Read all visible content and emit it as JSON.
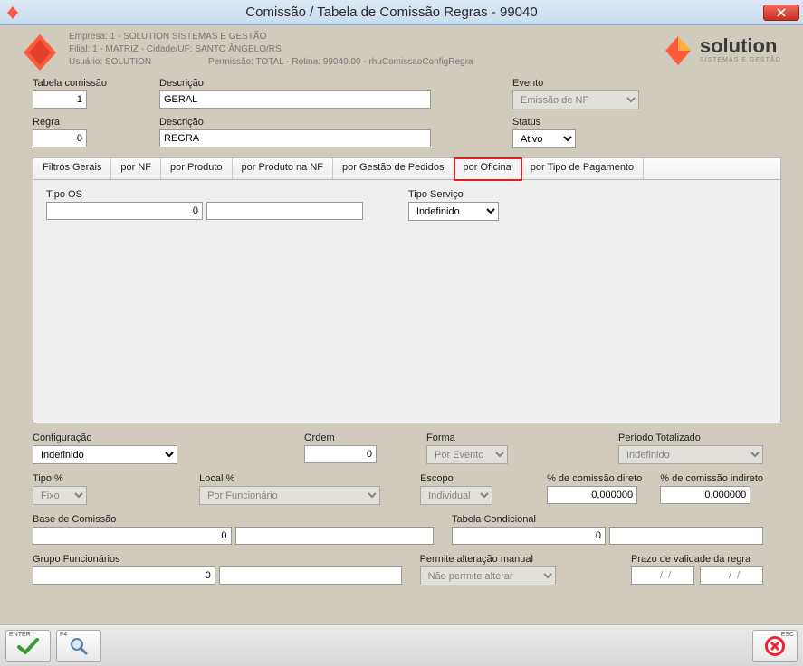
{
  "window": {
    "title": "Comissão / Tabela de Comissão Regras - 99040"
  },
  "meta": {
    "empresa": "Empresa: 1 - SOLUTION SISTEMAS E GESTÃO",
    "filial": "Filial: 1 - MATRIZ - Cidade/UF: SANTO ÂNGELO/RS",
    "usuario": "Usuário: SOLUTION",
    "permissao": "Permissão: TOTAL - Rotina: 99040.00 - rhuComissaoConfigRegra"
  },
  "brand": {
    "name": "solution",
    "tagline": "SISTEMAS E GESTÃO"
  },
  "top": {
    "tabela_label": "Tabela comissão",
    "tabela_val": "1",
    "desc1_label": "Descrição",
    "desc1_val": "GERAL",
    "evento_label": "Evento",
    "evento_val": "Emissão de NF",
    "regra_label": "Regra",
    "regra_val": "0",
    "desc2_label": "Descrição",
    "desc2_val": "REGRA",
    "status_label": "Status",
    "status_val": "Ativo"
  },
  "tabs": {
    "t0": "Filtros Gerais",
    "t1": "por NF",
    "t2": "por Produto",
    "t3": "por Produto na NF",
    "t4": "por Gestão de Pedidos",
    "t5": "por Oficina",
    "t6": "por Tipo de Pagamento"
  },
  "oficina": {
    "tipo_os_label": "Tipo OS",
    "tipo_os_val": "0",
    "tipo_os_desc": "",
    "tipo_serv_label": "Tipo Serviço",
    "tipo_serv_val": "Indefinido"
  },
  "cfg": {
    "config_label": "Configuração",
    "config_val": "Indefinido",
    "ordem_label": "Ordem",
    "ordem_val": "0",
    "forma_label": "Forma",
    "forma_val": "Por Evento",
    "periodo_label": "Período Totalizado",
    "periodo_val": "Indefinido",
    "tipo_pct_label": "Tipo %",
    "tipo_pct_val": "Fixo",
    "local_pct_label": "Local %",
    "local_pct_val": "Por Funcionário",
    "escopo_label": "Escopo",
    "escopo_val": "Individual",
    "pct_dir_label": "% de comissão direto",
    "pct_dir_val": "0,000000",
    "pct_ind_label": "% de comissão indireto",
    "pct_ind_val": "0,000000",
    "base_label": "Base de Comissão",
    "base_code": "0",
    "base_desc": "",
    "tabcond_label": "Tabela Condicional",
    "tabcond_code": "0",
    "tabcond_desc": "",
    "grupo_label": "Grupo Funcionários",
    "grupo_code": "0",
    "grupo_desc": "",
    "permite_label": "Permite alteração manual",
    "permite_val": "Não permite alterar",
    "prazo_label": "Prazo de validade da regra",
    "prazo_de": "  /  /",
    "prazo_ate": "  /  /"
  },
  "footer": {
    "enter_hint": "ENTER",
    "f4_hint": "F4",
    "esc_hint": "ESC"
  },
  "colors": {
    "accent": "#ff5a3c",
    "brand_blue": "#2b6cb0",
    "highlight": "#d22"
  }
}
